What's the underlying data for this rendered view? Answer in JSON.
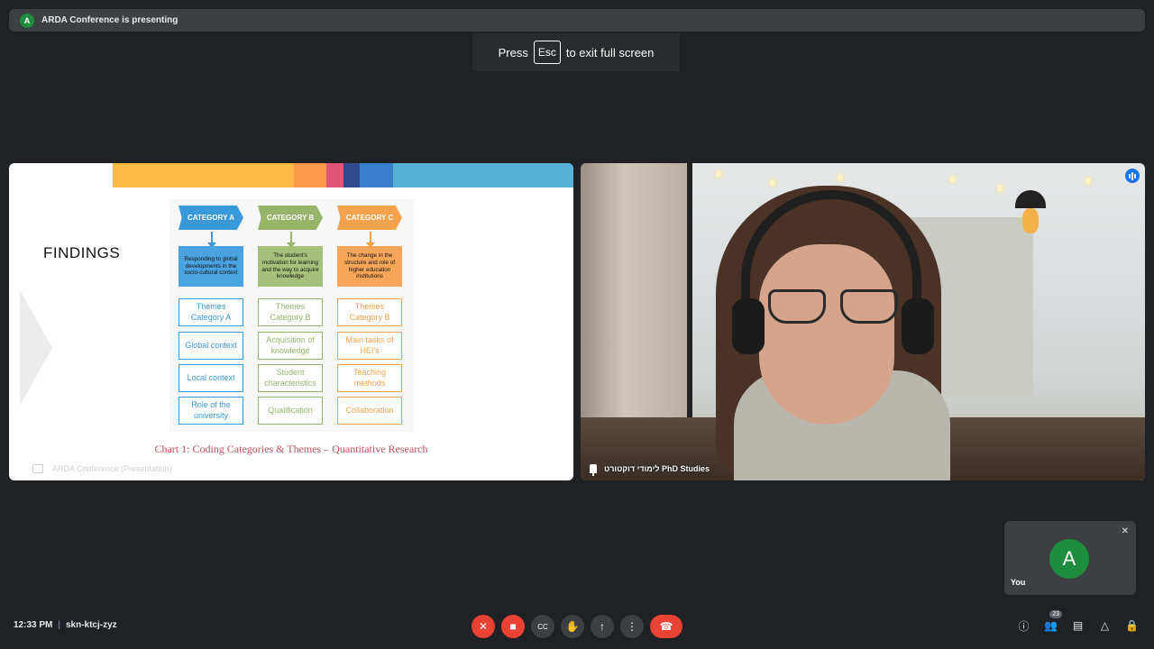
{
  "presenting_bar": {
    "avatar_letter": "A",
    "text": "ARDA Conference is presenting"
  },
  "esc_toast": {
    "press": "Press",
    "key": "Esc",
    "rest": "to exit full screen"
  },
  "slide": {
    "title": "FINDINGS",
    "stripe_colors": [
      "#fdb944",
      "#ff9a4d",
      "#e0547a",
      "#2f4a8f",
      "#3a7fce",
      "#56b3d6"
    ],
    "columns": [
      {
        "header": "CATEGORY A",
        "color": "#3a9ad9",
        "desc_bg": "#4aa3df",
        "description": "Responding to global developments in the socio-cultural context",
        "themes": [
          "Themes Category A",
          "Global context",
          "Local context",
          "Role of the university"
        ]
      },
      {
        "header": "CATEGORY B",
        "color": "#97b46b",
        "desc_bg": "#a5c07a",
        "description": "The student's motivation for learning and the way to acquire knowledge",
        "themes": [
          "Themes Category B",
          "Acquisition of knowledge",
          "Student characteristics",
          "Qualification"
        ]
      },
      {
        "header": "CATEGORY C",
        "color": "#f5a24d",
        "desc_bg": "#f7a558",
        "description": "The change in the structure and role of higher education institutions",
        "themes": [
          "Themes Category B",
          "Main tasks of HEI's",
          "Teaching methods",
          "Collaboration"
        ]
      }
    ],
    "caption": "Chart 1: Coding Categories & Themes – Quantitative Research",
    "tile_label": "ARDA Conference (Presentation)"
  },
  "video": {
    "name": "לימודי דוקטורט PhD Studies"
  },
  "self_view": {
    "avatar_letter": "A",
    "label": "You"
  },
  "meeting": {
    "time": "12:33 PM",
    "separator": "|",
    "code": "skn-ktcj-zyz"
  },
  "controls": [
    {
      "name": "mic-off-button",
      "icon": "✕",
      "style": "red"
    },
    {
      "name": "camera-off-button",
      "icon": "■",
      "style": "red"
    },
    {
      "name": "captions-button",
      "icon": "CC",
      "style": ""
    },
    {
      "name": "raise-hand-button",
      "icon": "✋",
      "style": ""
    },
    {
      "name": "present-button",
      "icon": "↑",
      "style": ""
    },
    {
      "name": "more-options-button",
      "icon": "⋮",
      "style": ""
    },
    {
      "name": "leave-call-button",
      "icon": "☎",
      "style": "end"
    }
  ],
  "right_controls": {
    "participants_count": "23"
  }
}
